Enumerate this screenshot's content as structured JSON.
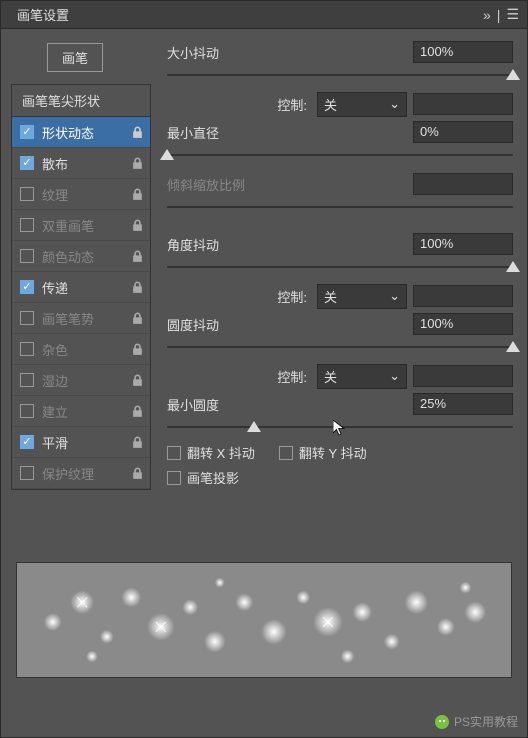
{
  "panel_title": "画笔设置",
  "brush_button": "画笔",
  "sidebar": {
    "header": "画笔笔尖形状",
    "items": [
      {
        "label": "形状动态",
        "checked": true,
        "locked": true,
        "selected": true
      },
      {
        "label": "散布",
        "checked": true,
        "locked": true,
        "selected": false
      },
      {
        "label": "纹理",
        "checked": false,
        "locked": true,
        "selected": false
      },
      {
        "label": "双重画笔",
        "checked": false,
        "locked": true,
        "selected": false
      },
      {
        "label": "颜色动态",
        "checked": false,
        "locked": true,
        "selected": false
      },
      {
        "label": "传递",
        "checked": true,
        "locked": true,
        "selected": false
      },
      {
        "label": "画笔笔势",
        "checked": false,
        "locked": true,
        "selected": false
      },
      {
        "label": "杂色",
        "checked": false,
        "locked": true,
        "selected": false
      },
      {
        "label": "湿边",
        "checked": false,
        "locked": true,
        "selected": false
      },
      {
        "label": "建立",
        "checked": false,
        "locked": true,
        "selected": false
      },
      {
        "label": "平滑",
        "checked": true,
        "locked": true,
        "selected": false
      },
      {
        "label": "保护纹理",
        "checked": false,
        "locked": true,
        "selected": false
      }
    ]
  },
  "main": {
    "size_jitter": {
      "label": "大小抖动",
      "value": "100%",
      "pos": 100
    },
    "control1": {
      "label": "控制:",
      "value": "关"
    },
    "min_diameter": {
      "label": "最小直径",
      "value": "0%",
      "pos": 0
    },
    "tilt_scale": {
      "label": "倾斜缩放比例",
      "value": ""
    },
    "angle_jitter": {
      "label": "角度抖动",
      "value": "100%",
      "pos": 100
    },
    "control2": {
      "label": "控制:",
      "value": "关"
    },
    "round_jitter": {
      "label": "圆度抖动",
      "value": "100%",
      "pos": 100
    },
    "control3": {
      "label": "控制:",
      "value": "关"
    },
    "min_round": {
      "label": "最小圆度",
      "value": "25%",
      "pos": 25
    },
    "flip_x": {
      "label": "翻转 X 抖动",
      "checked": false
    },
    "flip_y": {
      "label": "翻转 Y 抖动",
      "checked": false
    },
    "brush_proj": {
      "label": "画笔投影",
      "checked": false
    }
  },
  "watermark": "PS实用教程"
}
